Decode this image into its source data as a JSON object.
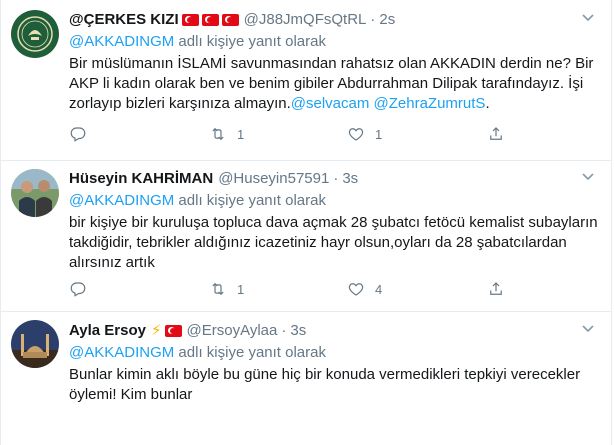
{
  "reply_prefix": "@AKKADINGM",
  "reply_suffix": "adlı kişiye yanıt olarak",
  "tweets": [
    {
      "name": "@ÇERKES KIZI",
      "handle": "@J88JmQFsQtRL",
      "dot": "·",
      "time": "2s",
      "text_main": "Bir müslümanın İSLAMİ savunmasından rahatsız olan AKKADIN derdin ne? Bir AKP li kadın olarak ben ve benim gibiler Abdurrahman Dilipak tarafındayız. İşi zorlayıp bizleri karşınıza almayın.",
      "mention1": "@selvacam",
      "mention2": "@ZehraZumrutS",
      "text_end": ".",
      "retweets": "1",
      "likes": "1"
    },
    {
      "name": "Hüseyin KAHRİMAN",
      "handle": "@Huseyin57591",
      "dot": "·",
      "time": "3s",
      "text": "bir kişiye bir kuruluşa topluca dava açmak 28 şubatcı fetöcü kemalist subayların takdiğidir, tebrikler aldığınız icazetiniz hayr olsun,oyları da 28 şabatcılardan alırsınız artık",
      "retweets": "1",
      "likes": "4"
    },
    {
      "name": "Ayla Ersoy",
      "handle": "@ErsoyAylaa",
      "dot": "·",
      "time": "3s",
      "text": "Bunlar kimin aklı böyle bu güne hiç bir konuda vermedikleri tepkiyi verecekler öylemi! Kim bunlar"
    }
  ],
  "icons": [
    "reply-icon",
    "retweet-icon",
    "like-icon",
    "share-icon",
    "chevron-down-icon",
    "lightning-icon",
    "turkish-flag-icon"
  ],
  "colors": {
    "link": "#1da1f2",
    "muted": "#657786",
    "text": "#14171a",
    "divider": "#e6ecf0"
  }
}
